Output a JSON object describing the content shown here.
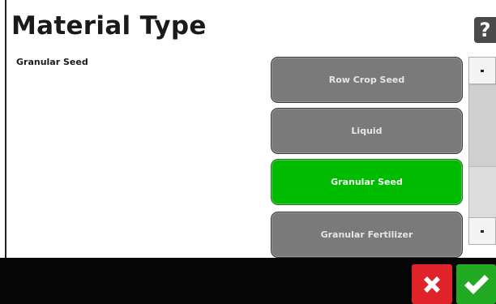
{
  "header": {
    "title": "Material Type",
    "help_label": "?"
  },
  "selection": {
    "current_value": "Granular Seed"
  },
  "options": [
    {
      "label": "Row Crop Seed",
      "selected": false
    },
    {
      "label": "Liquid",
      "selected": false
    },
    {
      "label": "Granular Seed",
      "selected": true
    },
    {
      "label": "Granular Fertilizer",
      "selected": false
    }
  ],
  "footer": {
    "cancel_icon": "x-icon",
    "confirm_icon": "checkmark-icon"
  },
  "colors": {
    "option_default": "#7a7a7a",
    "option_selected": "#00bb00",
    "cancel": "#e0232a",
    "confirm": "#22aa22",
    "bottom_bar": "#060606"
  }
}
